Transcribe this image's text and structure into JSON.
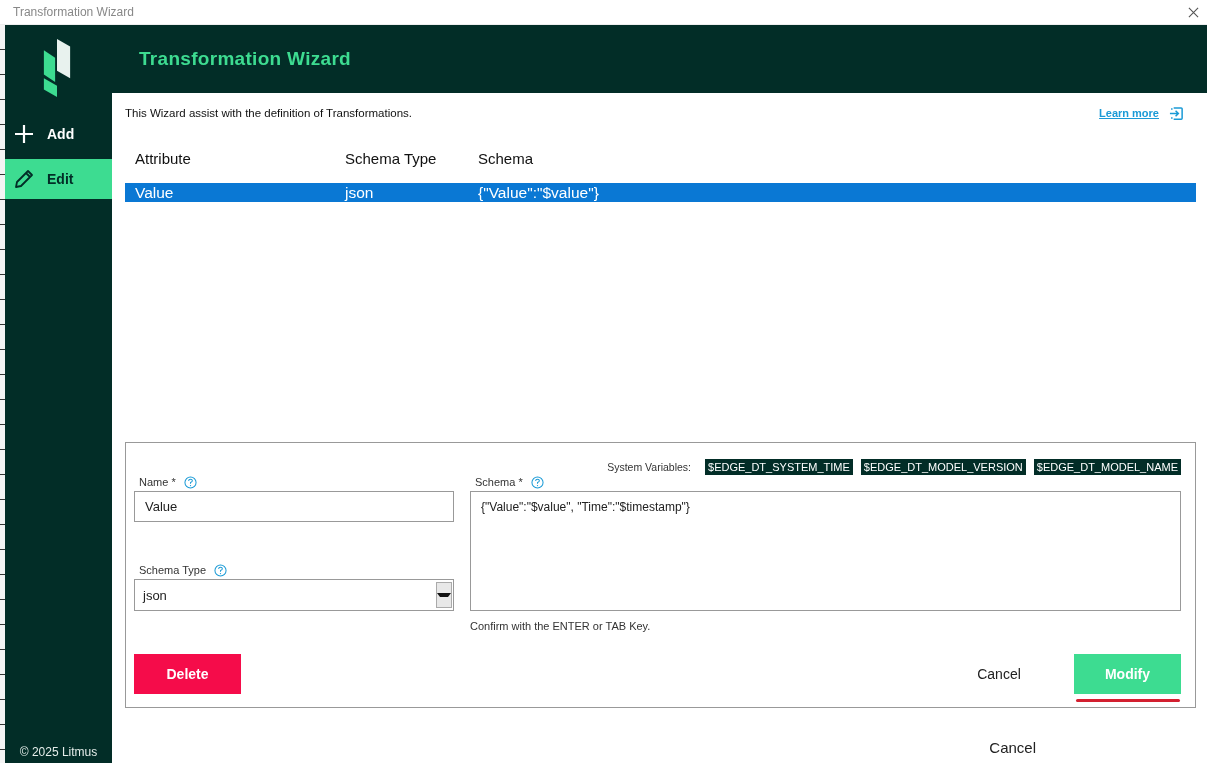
{
  "window": {
    "title": "Transformation Wizard"
  },
  "sidebar": {
    "items": [
      {
        "label": "Add",
        "kind": "add",
        "selected": false
      },
      {
        "label": "Edit",
        "kind": "edit",
        "selected": true
      }
    ],
    "footer": "© 2025 Litmus"
  },
  "header": {
    "title": "Transformation Wizard"
  },
  "intro": {
    "text": "This Wizard assist with the definition of Transformations.",
    "link": "Learn more"
  },
  "table": {
    "columns": [
      "Attribute",
      "Schema Type",
      "Schema"
    ],
    "rows": [
      {
        "cells": [
          "Value",
          "json",
          "{\"Value\":\"$value\"}"
        ],
        "selected": true
      }
    ]
  },
  "form": {
    "name": {
      "label": "Name *",
      "value": "Value"
    },
    "schema_type": {
      "label": "Schema Type",
      "value": "json"
    },
    "system_variables": {
      "label": "System Variables:",
      "chips": [
        "$EDGE_DT_SYSTEM_TIME",
        "$EDGE_DT_MODEL_VERSION",
        "$EDGE_DT_MODEL_NAME"
      ]
    },
    "schema": {
      "label": "Schema *",
      "value": "{\"Value\":\"$value\", \"Time\":\"$timestamp\"}",
      "hint": "Confirm with the ENTER or TAB Key."
    },
    "buttons": [
      {
        "label": "Delete",
        "kind": "danger",
        "underlined": false
      },
      {
        "label": "Cancel",
        "kind": "plain",
        "underlined": false
      },
      {
        "label": "Modify",
        "kind": "primary",
        "underlined": true
      }
    ]
  },
  "footer": {
    "cancel": "Cancel"
  }
}
